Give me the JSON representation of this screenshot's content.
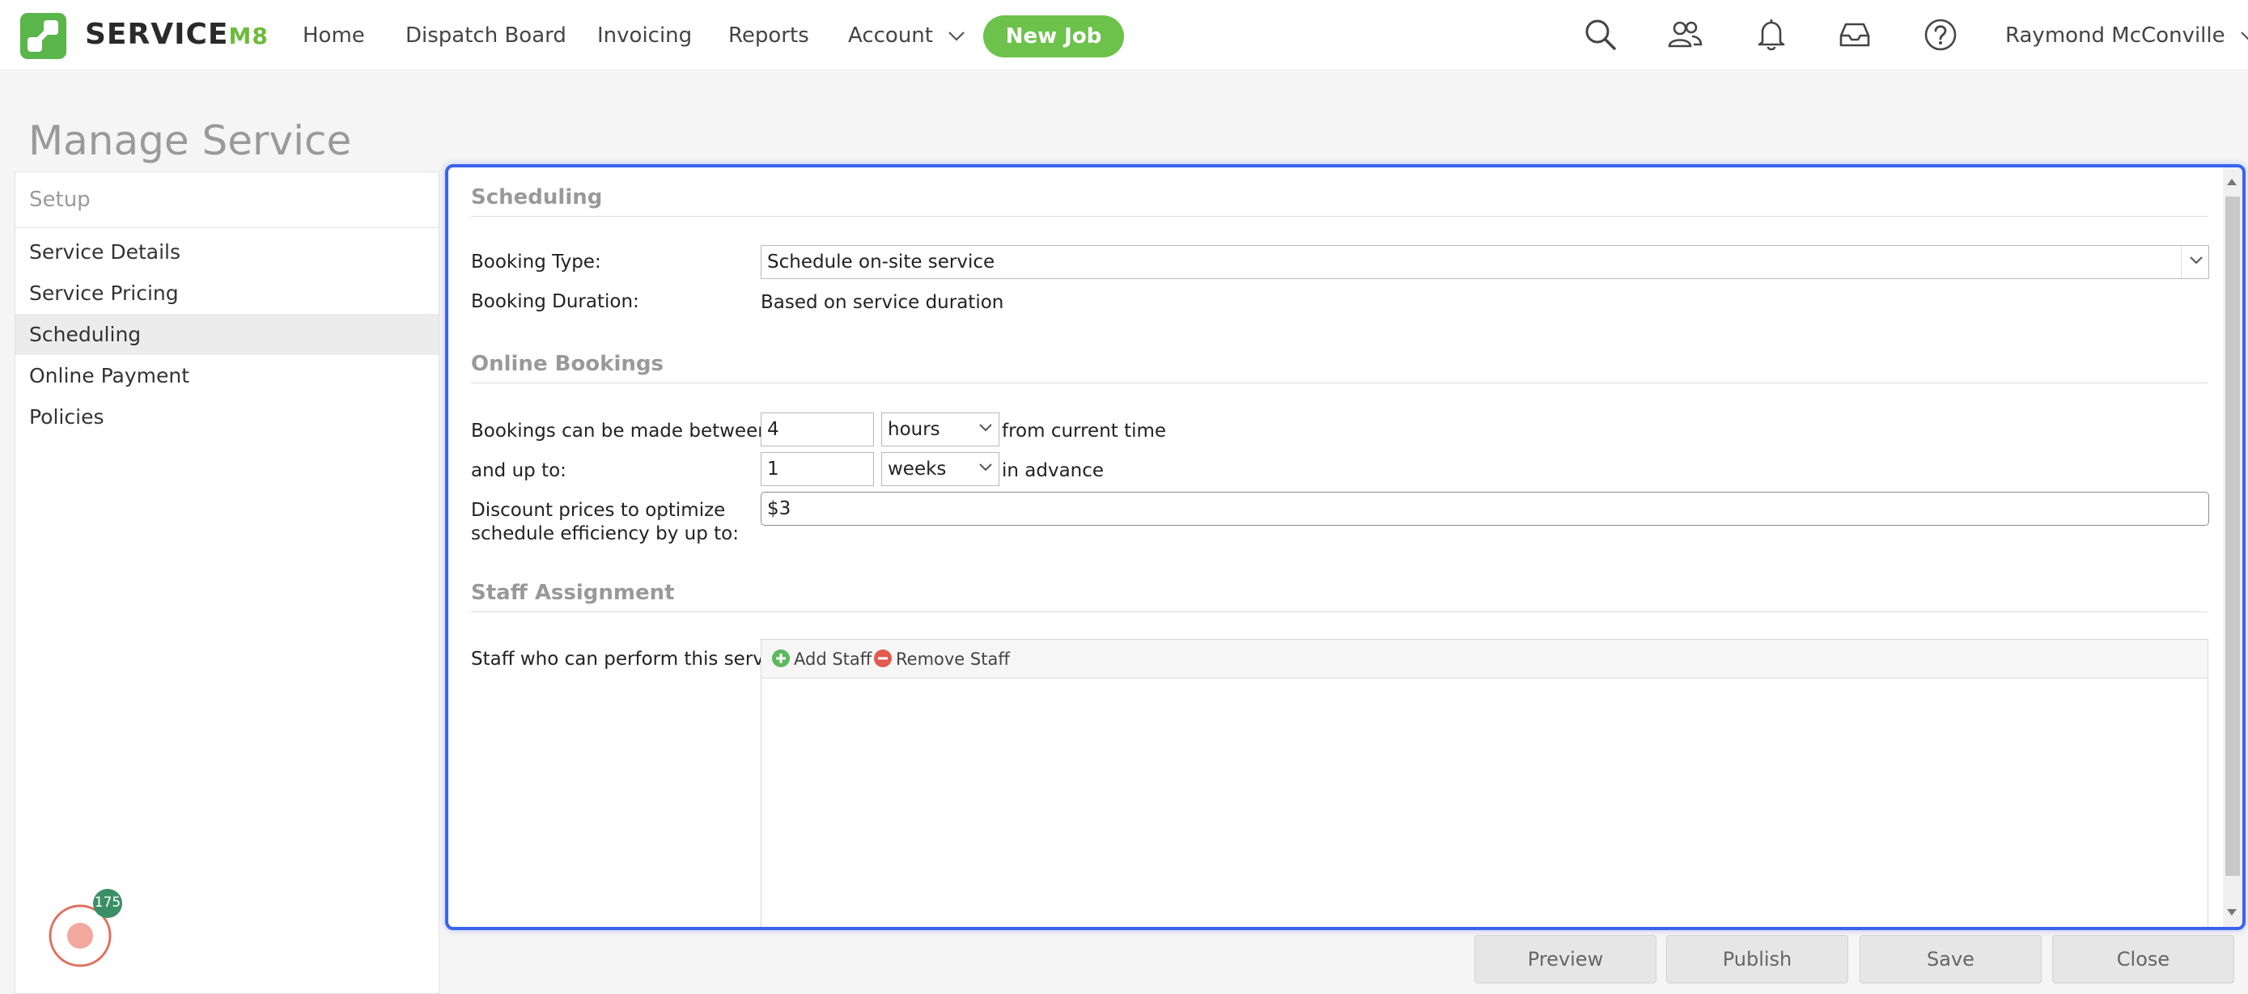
{
  "app": {
    "logo_text_main": "SERVICE",
    "logo_text_suffix": "M8",
    "brand_color": "#5ab54b"
  },
  "nav": {
    "items": [
      {
        "label": "Home"
      },
      {
        "label": "Dispatch Board"
      },
      {
        "label": "Invoicing"
      },
      {
        "label": "Reports"
      },
      {
        "label": "Account",
        "has_dropdown": true
      }
    ],
    "new_job_label": "New Job",
    "icons": [
      "search-icon",
      "people-icon",
      "bell-icon",
      "inbox-icon",
      "help-icon"
    ],
    "user_name": "Raymond McConville"
  },
  "page": {
    "title": "Manage Service"
  },
  "sidebar": {
    "header": "Setup",
    "items": [
      {
        "label": "Service Details",
        "active": false
      },
      {
        "label": "Service Pricing",
        "active": false
      },
      {
        "label": "Scheduling",
        "active": true
      },
      {
        "label": "Online Payment",
        "active": false
      },
      {
        "label": "Policies",
        "active": false
      }
    ],
    "notification_count": "175"
  },
  "scheduling": {
    "section_title": "Scheduling",
    "booking_type_label": "Booking Type:",
    "booking_type_value": "Schedule on-site service",
    "booking_duration_label": "Booking Duration:",
    "booking_duration_value": "Based on service duration"
  },
  "online_bookings": {
    "section_title": "Online Bookings",
    "between_label": "Bookings can be made between:",
    "between_value": "4",
    "between_unit": "hours",
    "between_suffix": "from current time",
    "up_to_label": "and up to:",
    "up_to_value": "1",
    "up_to_unit": "weeks",
    "up_to_suffix": "in advance",
    "discount_label_line1": "Discount prices to optimize",
    "discount_label_line2": "schedule efficiency by up to:",
    "discount_value": "$3"
  },
  "staff": {
    "section_title": "Staff Assignment",
    "label": "Staff who can perform this service:",
    "add_label": "Add Staff",
    "remove_label": "Remove Staff"
  },
  "footer": {
    "preview_label": "Preview",
    "publish_label": "Publish",
    "save_label": "Save",
    "close_label": "Close"
  }
}
